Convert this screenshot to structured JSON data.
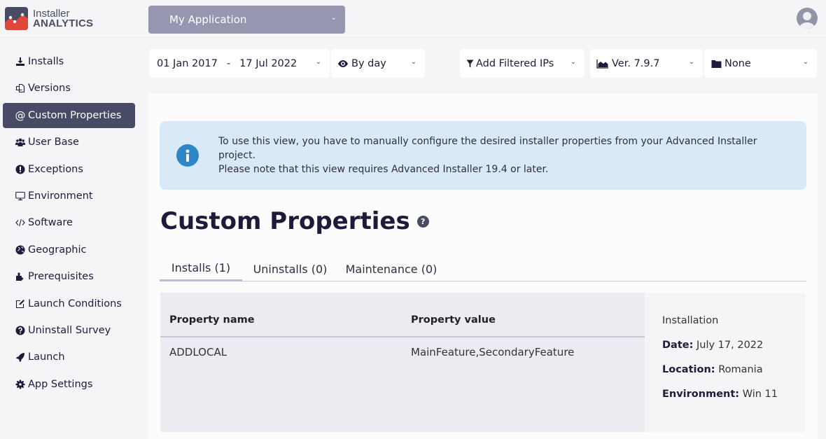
{
  "brand": {
    "line1": "Installer",
    "line2": "ANALYTICS",
    "colors": {
      "dark": "#474b65",
      "red": "#e0493a"
    }
  },
  "header": {
    "app_selector": {
      "value": "My Application",
      "icon": "chevron-down-icon"
    },
    "avatar_icon": "user-avatar-icon"
  },
  "sidebar": {
    "active_color": "#474b65",
    "items": [
      {
        "label": "Installs",
        "icon": "download-icon",
        "active": false
      },
      {
        "label": "Versions",
        "icon": "copy-icon",
        "active": false
      },
      {
        "label": "Custom Properties",
        "icon": "at-icon",
        "active": true
      },
      {
        "label": "User Base",
        "icon": "users-icon",
        "active": false
      },
      {
        "label": "Exceptions",
        "icon": "exclamation-circle-icon",
        "active": false
      },
      {
        "label": "Environment",
        "icon": "desktop-icon",
        "active": false
      },
      {
        "label": "Software",
        "icon": "code-icon",
        "active": false
      },
      {
        "label": "Geographic",
        "icon": "globe-icon",
        "active": false
      },
      {
        "label": "Prerequisites",
        "icon": "puzzle-icon",
        "active": false
      },
      {
        "label": "Launch Conditions",
        "icon": "edit-icon",
        "active": false
      },
      {
        "label": "Uninstall Survey",
        "icon": "question-circle-icon",
        "active": false
      },
      {
        "label": "Launch",
        "icon": "rocket-icon",
        "active": false
      },
      {
        "label": "App Settings",
        "icon": "gear-icon",
        "active": false
      }
    ]
  },
  "filters": {
    "date_range": {
      "start": "01 Jan 2017",
      "separator": "-",
      "end": "17 Jul 2022"
    },
    "granularity": {
      "value": "By day",
      "icon": "eye-icon"
    },
    "ip_filter": {
      "value": "Add Filtered IPs",
      "icon": "filter-icon"
    },
    "version": {
      "value": "Ver. 7.9.7",
      "icon": "area-chart-icon"
    },
    "folder": {
      "value": "None",
      "icon": "folder-icon"
    }
  },
  "info": {
    "icon": "info-circle-icon",
    "line1": "To use this view, you have to manually configure the desired installer properties from your Advanced Installer project.",
    "line2": "Please note that this view requires Advanced Installer 19.4 or later.",
    "color": "#2e86c6"
  },
  "page": {
    "title": "Custom Properties",
    "help_icon": "question-circle-icon",
    "tabs": [
      {
        "label": "Installs (1)",
        "active": true
      },
      {
        "label": "Uninstalls (0)",
        "active": false
      },
      {
        "label": "Maintenance (0)",
        "active": false
      }
    ]
  },
  "table": {
    "columns": [
      "Property name",
      "Property value"
    ],
    "rows": [
      [
        "ADDLOCAL",
        "MainFeature,SecondaryFeature"
      ]
    ]
  },
  "details": {
    "heading": "Installation",
    "fields": [
      {
        "label": "Date:",
        "value": "July 17, 2022"
      },
      {
        "label": "Location:",
        "value": "Romania"
      },
      {
        "label": "Environment:",
        "value": "Win 11"
      }
    ]
  }
}
